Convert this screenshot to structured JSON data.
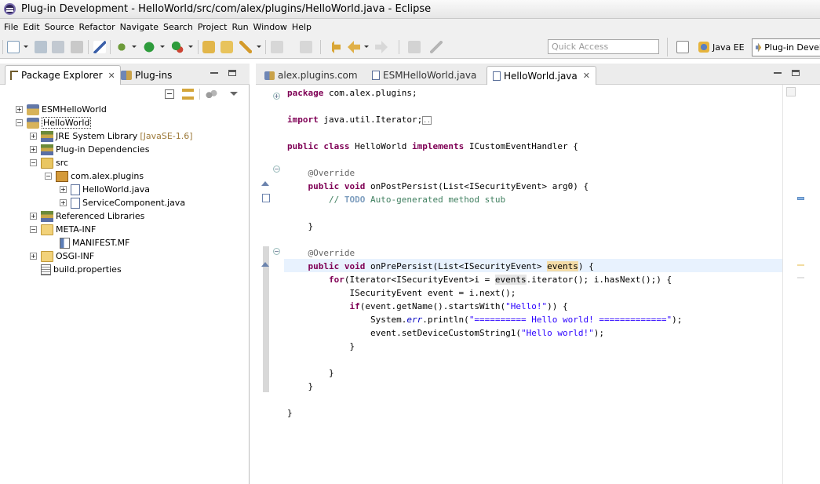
{
  "window": {
    "title": "Plug-in Development - HelloWorld/src/com/alex/plugins/HelloWorld.java - Eclipse"
  },
  "menu": [
    "File",
    "Edit",
    "Source",
    "Refactor",
    "Navigate",
    "Search",
    "Project",
    "Run",
    "Window",
    "Help"
  ],
  "toolbar": {
    "quick_access_placeholder": "Quick Access",
    "perspectives": [
      "Java EE",
      "Plug-in Devel"
    ]
  },
  "left_view": {
    "tabs": [
      "Package Explorer",
      "Plug-ins"
    ],
    "tree": [
      {
        "label": "ESMHelloWorld",
        "expander": "+",
        "icon": "project-icon"
      },
      {
        "label": "HelloWorld",
        "expander": "-",
        "icon": "project-icon",
        "selected": true
      },
      {
        "label": "JRE System Library",
        "decoration": "[JavaSE-1.6]",
        "expander": "+",
        "icon": "library-icon"
      },
      {
        "label": "Plug-in Dependencies",
        "expander": "+",
        "icon": "library-icon"
      },
      {
        "label": "src",
        "expander": "-",
        "icon": "source-folder-icon"
      },
      {
        "label": "com.alex.plugins",
        "expander": "-",
        "icon": "package-icon"
      },
      {
        "label": "HelloWorld.java",
        "expander": "+",
        "icon": "java-file-icon"
      },
      {
        "label": "ServiceComponent.java",
        "expander": "+",
        "icon": "java-file-icon"
      },
      {
        "label": "Referenced Libraries",
        "expander": "+",
        "icon": "library-icon"
      },
      {
        "label": "META-INF",
        "expander": "-",
        "icon": "folder-icon"
      },
      {
        "label": "MANIFEST.MF",
        "expander": "",
        "icon": "manifest-icon"
      },
      {
        "label": "OSGI-INF",
        "expander": "+",
        "icon": "folder-icon"
      },
      {
        "label": "build.properties",
        "expander": "",
        "icon": "properties-file-icon"
      }
    ]
  },
  "editor": {
    "tabs": [
      {
        "label": "alex.plugins.com",
        "icon": "plugin-manifest-icon"
      },
      {
        "label": "ESMHelloWorld.java",
        "icon": "java-file-icon"
      },
      {
        "label": "HelloWorld.java",
        "icon": "java-file-icon",
        "active": true
      }
    ],
    "code": {
      "package_kw": "package",
      "package_name": " com.alex.plugins;",
      "import_kw": "import",
      "import_name": " java.util.Iterator;",
      "import_fold": "..",
      "public": "public",
      "class": "class",
      "implements": "implements",
      "class_name": " HelloWorld ",
      "interface": " ICustomEventHandler {",
      "override": "@Override",
      "void": "void",
      "m1_sig": " onPostPersist(List<ISecurityEvent> arg0) {",
      "comment_start": "// ",
      "todo": "TODO",
      "comment_rest": " Auto-generated method stub",
      "close_brace": "}",
      "m2_name": " onPrePersist",
      "m2_params": "(List<ISecurityEvent> ",
      "events": "events",
      "m2_end": ") {",
      "for_kw": "for",
      "for_a": "(Iterator<ISecurityEvent>i = ",
      "for_b": ".iterator(); i.hasNext();) {",
      "decl": "ISecurityEvent event = i.next();",
      "if_kw": "if",
      "if_a": "(event.getName().startsWith(",
      "hello_bang": "\"Hello!\"",
      "if_b": ")) {",
      "sys": "System.",
      "err": "err",
      "println": ".println(",
      "banner": "\"========== Hello world! =============\"",
      "stmt_end": ");",
      "setdev": "event.setDeviceCustomString1(",
      "hello_world": "\"Hello world!\""
    }
  },
  "colors": {
    "keyword": "#7f0055",
    "annotation": "#646464",
    "comment": "#3f7f5f",
    "string": "#2a00ff",
    "occurrence_highlight": "#f4dca7",
    "current_line": "#e8f2fe"
  }
}
